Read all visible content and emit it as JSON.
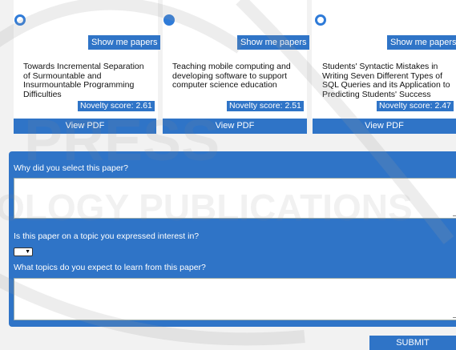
{
  "cards": [
    {
      "selected": false,
      "show_label": "Show me papers",
      "title": "Towards Incremental Separation of Surmountable and Insurmountable Programming Difficulties",
      "novelty": "Novelty score: 2.61",
      "pdf_label": "View PDF"
    },
    {
      "selected": true,
      "show_label": "Show me papers",
      "title": "Teaching mobile computing and developing software to support computer science education",
      "novelty": "Novelty score: 2.51",
      "pdf_label": "View PDF"
    },
    {
      "selected": false,
      "show_label": "Show me papers",
      "title": "Students' Syntactic Mistakes in Writing Seven Different Types of SQL Queries and its Application to Predicting Students' Success",
      "novelty": "Novelty score: 2.47",
      "pdf_label": "View PDF"
    }
  ],
  "form": {
    "q1_label": "Why did you select this paper?",
    "q1_value": "",
    "q2_label": "Is this paper on a topic you expressed interest in?",
    "q2_selected": "",
    "q3_label": "What topics do you expect to learn from this paper?",
    "q3_value": "",
    "submit_label": "SUBMIT"
  },
  "watermark_text": "SCITEPRESS SCIENCE AND TECHNOLOGY PUBLICATIONS",
  "colors": {
    "accent": "#2f74c7",
    "radio": "#2f7bd8",
    "background": "#f2f2f2"
  }
}
